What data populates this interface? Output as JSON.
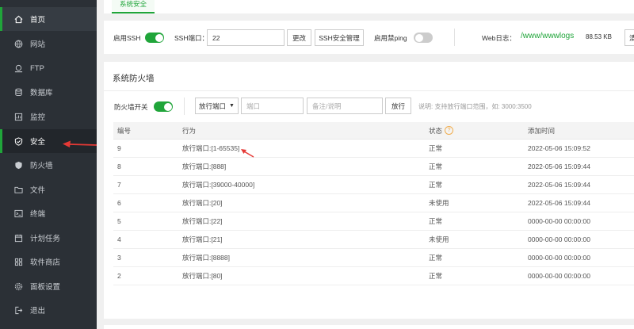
{
  "sidebar": {
    "items": [
      {
        "label": "首页",
        "icon": "home-icon"
      },
      {
        "label": "网站",
        "icon": "globe-icon"
      },
      {
        "label": "FTP",
        "icon": "ftp-icon"
      },
      {
        "label": "数据库",
        "icon": "database-icon"
      },
      {
        "label": "监控",
        "icon": "monitor-icon"
      },
      {
        "label": "安全",
        "icon": "shield-icon"
      },
      {
        "label": "防火墙",
        "icon": "firewall-icon"
      },
      {
        "label": "文件",
        "icon": "folder-icon"
      },
      {
        "label": "终端",
        "icon": "terminal-icon"
      },
      {
        "label": "计划任务",
        "icon": "calendar-icon"
      },
      {
        "label": "软件商店",
        "icon": "apps-icon"
      },
      {
        "label": "面板设置",
        "icon": "gear-icon"
      },
      {
        "label": "退出",
        "icon": "logout-icon"
      }
    ]
  },
  "tabs": {
    "security": "系统安全"
  },
  "ssh": {
    "enable_label": "启用SSH",
    "port_label": "SSH端口：",
    "port_value": "22",
    "change_button": "更改",
    "manage_button": "SSH安全管理",
    "ping_label": "启用禁ping",
    "weblog_label": "Web日志：",
    "weblog_path": "/www/wwwlogs",
    "weblog_size": "88.53 KB",
    "clean_button": "清"
  },
  "firewall": {
    "title": "系统防火墙",
    "switch_label": "防火墙开关",
    "select_value": "放行端口",
    "port_placeholder": "端口",
    "remark_placeholder": "备注/说明",
    "allow_button": "放行",
    "hint": "说明: 支持放行端口范围，如: 3000:3500",
    "columns": {
      "id": "编号",
      "action": "行为",
      "status": "状态",
      "time": "添加时间"
    },
    "help_mark": "?",
    "rows": [
      {
        "id": "9",
        "action": "放行端口:[1-65535]",
        "status": "正常",
        "time": "2022-05-06 15:09:52"
      },
      {
        "id": "8",
        "action": "放行端口:[888]",
        "status": "正常",
        "time": "2022-05-06 15:09:44"
      },
      {
        "id": "7",
        "action": "放行端口:[39000-40000]",
        "status": "正常",
        "time": "2022-05-06 15:09:44"
      },
      {
        "id": "6",
        "action": "放行端口:[20]",
        "status": "未使用",
        "time": "2022-05-06 15:09:44"
      },
      {
        "id": "5",
        "action": "放行端口:[22]",
        "status": "正常",
        "time": "0000-00-00 00:00:00"
      },
      {
        "id": "4",
        "action": "放行端口:[21]",
        "status": "未使用",
        "time": "0000-00-00 00:00:00"
      },
      {
        "id": "3",
        "action": "放行端口:[8888]",
        "status": "正常",
        "time": "0000-00-00 00:00:00"
      },
      {
        "id": "2",
        "action": "放行端口:[80]",
        "status": "正常",
        "time": "0000-00-00 00:00:00"
      }
    ]
  },
  "colors": {
    "accent": "#20a53a",
    "annotation": "#e53935",
    "sidebar_bg": "#2b3036"
  }
}
